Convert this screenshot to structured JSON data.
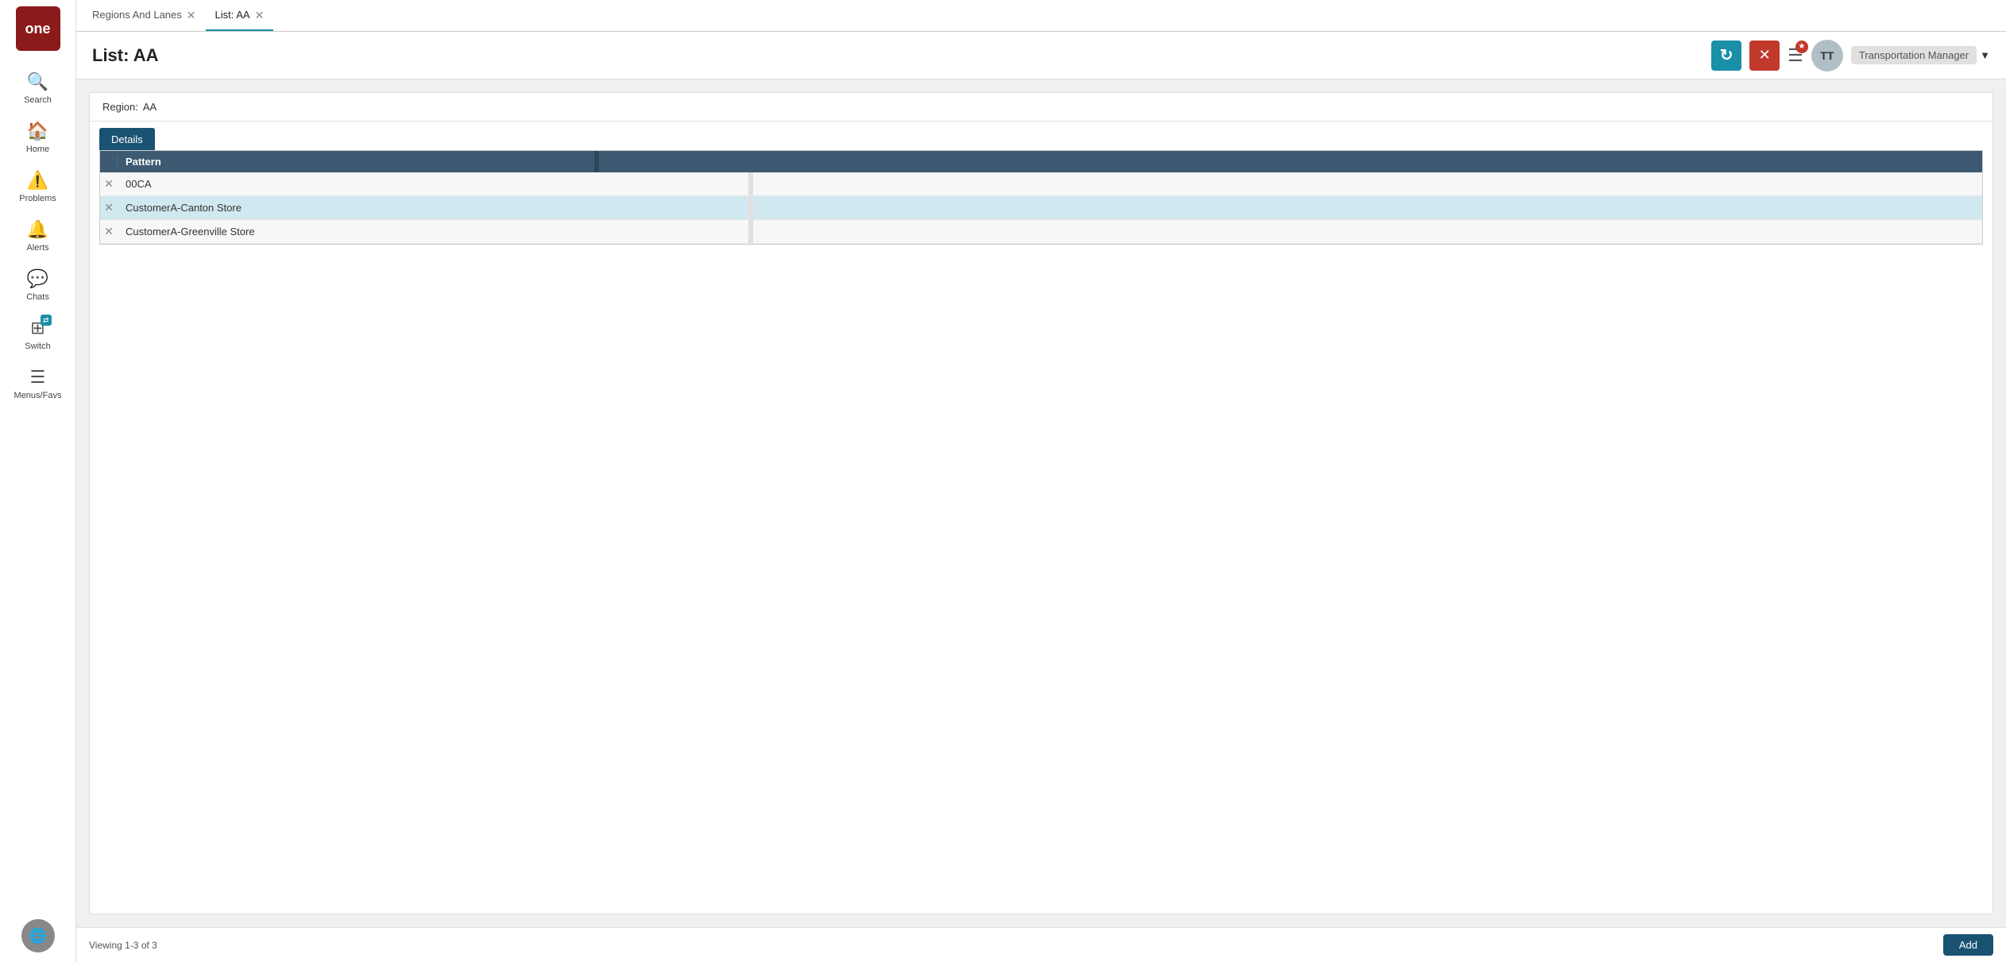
{
  "app": {
    "logo_text": "one"
  },
  "sidebar": {
    "items": [
      {
        "id": "search",
        "label": "Search",
        "icon": "🔍"
      },
      {
        "id": "home",
        "label": "Home",
        "icon": "🏠"
      },
      {
        "id": "problems",
        "label": "Problems",
        "icon": "⚠️"
      },
      {
        "id": "alerts",
        "label": "Alerts",
        "icon": "🔔"
      },
      {
        "id": "chats",
        "label": "Chats",
        "icon": "💬"
      },
      {
        "id": "switch",
        "label": "Switch",
        "icon": "⇄"
      },
      {
        "id": "menus",
        "label": "Menus/Favs",
        "icon": "☰"
      }
    ],
    "avatar_icon": "🌐"
  },
  "tabs": [
    {
      "id": "regions-lanes",
      "label": "Regions And Lanes",
      "active": false,
      "closeable": true
    },
    {
      "id": "list-aa",
      "label": "List: AA",
      "active": true,
      "closeable": true
    }
  ],
  "header": {
    "title": "List: AA",
    "refresh_label": "↻",
    "close_label": "✕",
    "menu_label": "☰",
    "menu_badge": "★",
    "user_initials": "TT",
    "user_role": "Transportation Manager",
    "dropdown_arrow": "▼"
  },
  "content": {
    "region_label": "Region:",
    "region_value": "AA",
    "details_tab_label": "Details",
    "table": {
      "header_expand": "",
      "columns": [
        {
          "id": "pattern",
          "label": "Pattern"
        }
      ],
      "rows": [
        {
          "id": 1,
          "pattern": "00CA"
        },
        {
          "id": 2,
          "pattern": "CustomerA-Canton Store"
        },
        {
          "id": 3,
          "pattern": "CustomerA-Greenville Store"
        }
      ]
    },
    "viewing_text": "Viewing 1-3 of 3",
    "add_button_label": "Add"
  }
}
